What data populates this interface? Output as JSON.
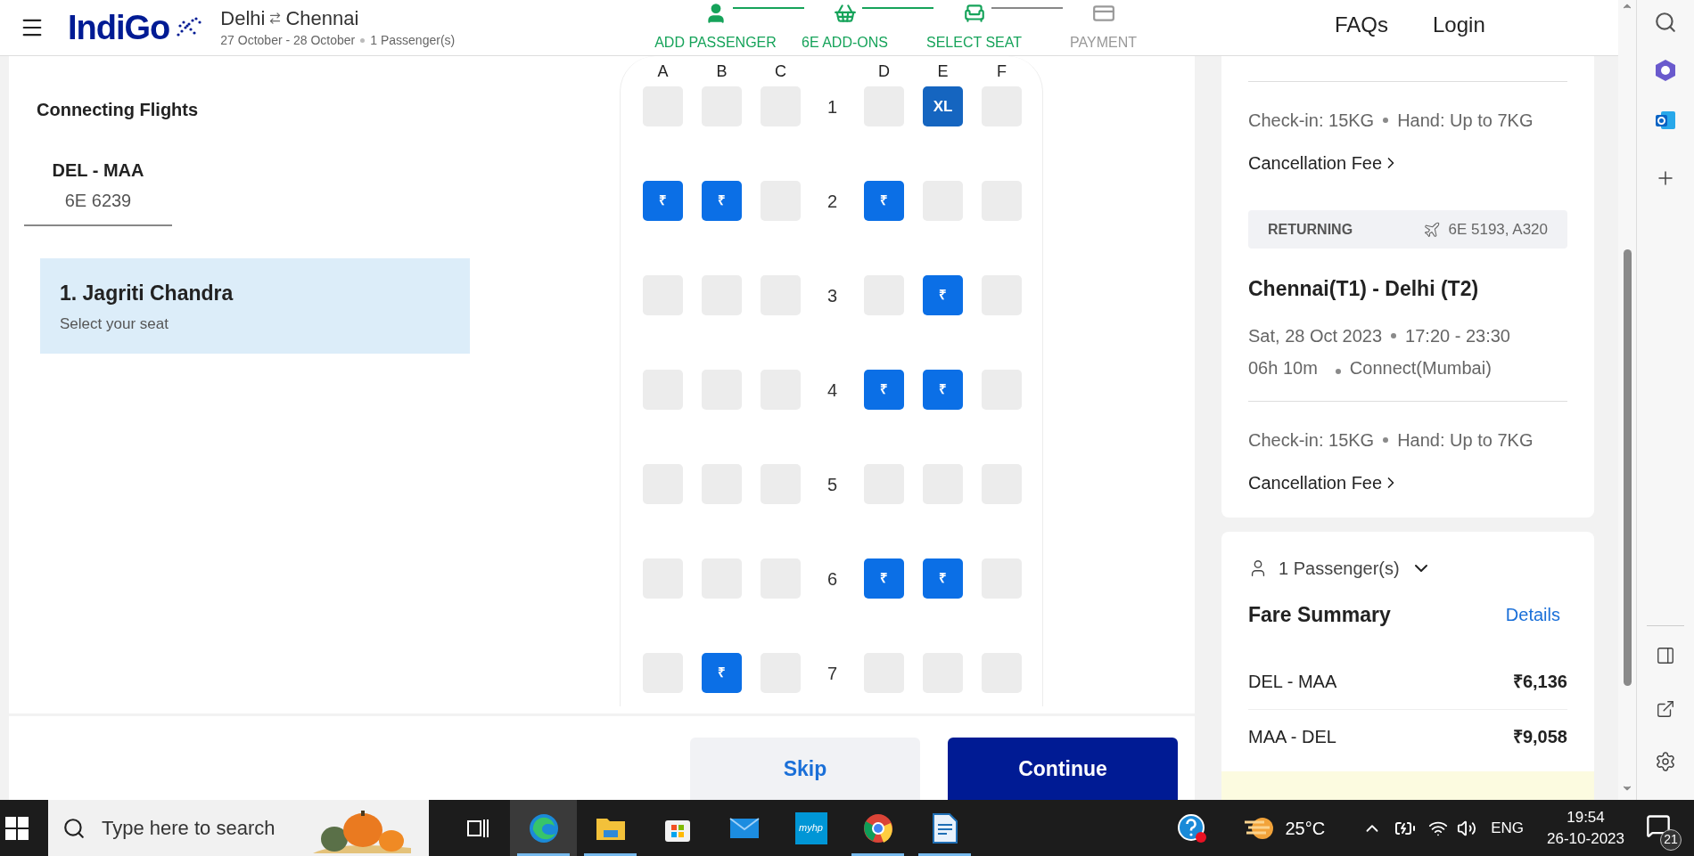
{
  "header": {
    "brand": "IndiGo",
    "route_from": "Delhi",
    "route_to": "Chennai",
    "dates": "27 October - 28 October",
    "passengers": "1 Passenger(s)",
    "steps": [
      {
        "kind": "passenger",
        "label": "ADD PASSENGER",
        "done": true
      },
      {
        "kind": "addons",
        "label": "6E ADD-ONS",
        "done": true
      },
      {
        "kind": "seat",
        "label": "SELECT SEAT",
        "done": true
      },
      {
        "kind": "payment",
        "label": "PAYMENT",
        "done": false
      }
    ],
    "links": [
      "FAQs",
      "Login"
    ]
  },
  "left_panel": {
    "heading": "Connecting Flights",
    "flight_tabs": [
      {
        "route": "DEL - MAA",
        "flight": "6E 6239",
        "selected": true
      }
    ],
    "passengers": [
      {
        "name": "1. Jagriti Chandra",
        "hint": "Select your seat",
        "selected": true
      }
    ]
  },
  "seat_map": {
    "columns": [
      "A",
      "B",
      "C",
      "D",
      "E",
      "F"
    ],
    "rows": [
      {
        "number": "1",
        "seats": [
          {
            "kind": "available"
          },
          {
            "kind": "available"
          },
          {
            "kind": "available"
          },
          {
            "kind": "available"
          },
          {
            "kind": "xl",
            "label": "XL"
          },
          {
            "kind": "available"
          }
        ]
      },
      {
        "number": "2",
        "seats": [
          {
            "kind": "paid",
            "label": "₹"
          },
          {
            "kind": "paid",
            "label": "₹"
          },
          {
            "kind": "available"
          },
          {
            "kind": "paid",
            "label": "₹"
          },
          {
            "kind": "available"
          },
          {
            "kind": "available"
          }
        ]
      },
      {
        "number": "3",
        "seats": [
          {
            "kind": "available"
          },
          {
            "kind": "available"
          },
          {
            "kind": "available"
          },
          {
            "kind": "available"
          },
          {
            "kind": "paid",
            "label": "₹"
          },
          {
            "kind": "available"
          }
        ]
      },
      {
        "number": "4",
        "seats": [
          {
            "kind": "available"
          },
          {
            "kind": "available"
          },
          {
            "kind": "available"
          },
          {
            "kind": "paid",
            "label": "₹"
          },
          {
            "kind": "paid",
            "label": "₹"
          },
          {
            "kind": "available"
          }
        ]
      },
      {
        "number": "5",
        "seats": [
          {
            "kind": "available"
          },
          {
            "kind": "available"
          },
          {
            "kind": "available"
          },
          {
            "kind": "available"
          },
          {
            "kind": "available"
          },
          {
            "kind": "available"
          }
        ]
      },
      {
        "number": "6",
        "seats": [
          {
            "kind": "available"
          },
          {
            "kind": "available"
          },
          {
            "kind": "available"
          },
          {
            "kind": "paid",
            "label": "₹"
          },
          {
            "kind": "paid",
            "label": "₹"
          },
          {
            "kind": "available"
          }
        ]
      },
      {
        "number": "7",
        "seats": [
          {
            "kind": "available"
          },
          {
            "kind": "paid",
            "label": "₹"
          },
          {
            "kind": "available"
          },
          {
            "kind": "available"
          },
          {
            "kind": "available"
          },
          {
            "kind": "available"
          }
        ]
      }
    ]
  },
  "actions": [
    {
      "kind": "secondary",
      "label": "Skip"
    },
    {
      "kind": "primary",
      "label": "Continue"
    }
  ],
  "trip_summary": {
    "onward": {
      "checkin": "Check-in: 15KG",
      "hand": "Hand: Up to 7KG",
      "cancellation": "Cancellation Fee"
    },
    "returning": {
      "tag": "RETURNING",
      "flight": "6E 5193, A320",
      "route": "Chennai(T1) - Delhi (T2)",
      "date": "Sat, 28 Oct 2023",
      "time": "17:20 - 23:30",
      "duration": "06h 10m",
      "connection": "Connect(Mumbai)",
      "checkin": "Check-in: 15KG",
      "hand": "Hand: Up to 7KG",
      "cancellation": "Cancellation Fee"
    }
  },
  "fare_summary": {
    "passengers": "1 Passenger(s)",
    "title": "Fare Summary",
    "details_link": "Details",
    "lines": [
      {
        "route": "DEL - MAA",
        "amount": "₹6,136"
      },
      {
        "route": "MAA - DEL",
        "amount": "₹9,058"
      }
    ]
  },
  "taskbar": {
    "search_placeholder": "Type here to search",
    "apps": [
      {
        "kind": "taskview",
        "running": false,
        "selected": false
      },
      {
        "kind": "edge",
        "running": true,
        "selected": true
      },
      {
        "kind": "explorer",
        "running": true,
        "selected": false
      },
      {
        "kind": "store",
        "running": false,
        "selected": false
      },
      {
        "kind": "mail",
        "running": false,
        "selected": false
      },
      {
        "kind": "myhp",
        "running": false,
        "selected": false,
        "label": "myhp"
      },
      {
        "kind": "chrome",
        "running": true,
        "selected": false
      },
      {
        "kind": "writer",
        "running": true,
        "selected": false
      }
    ],
    "temperature": "25°C",
    "language": "ENG",
    "time": "19:54",
    "date": "26-10-2023",
    "notifications": "21"
  }
}
